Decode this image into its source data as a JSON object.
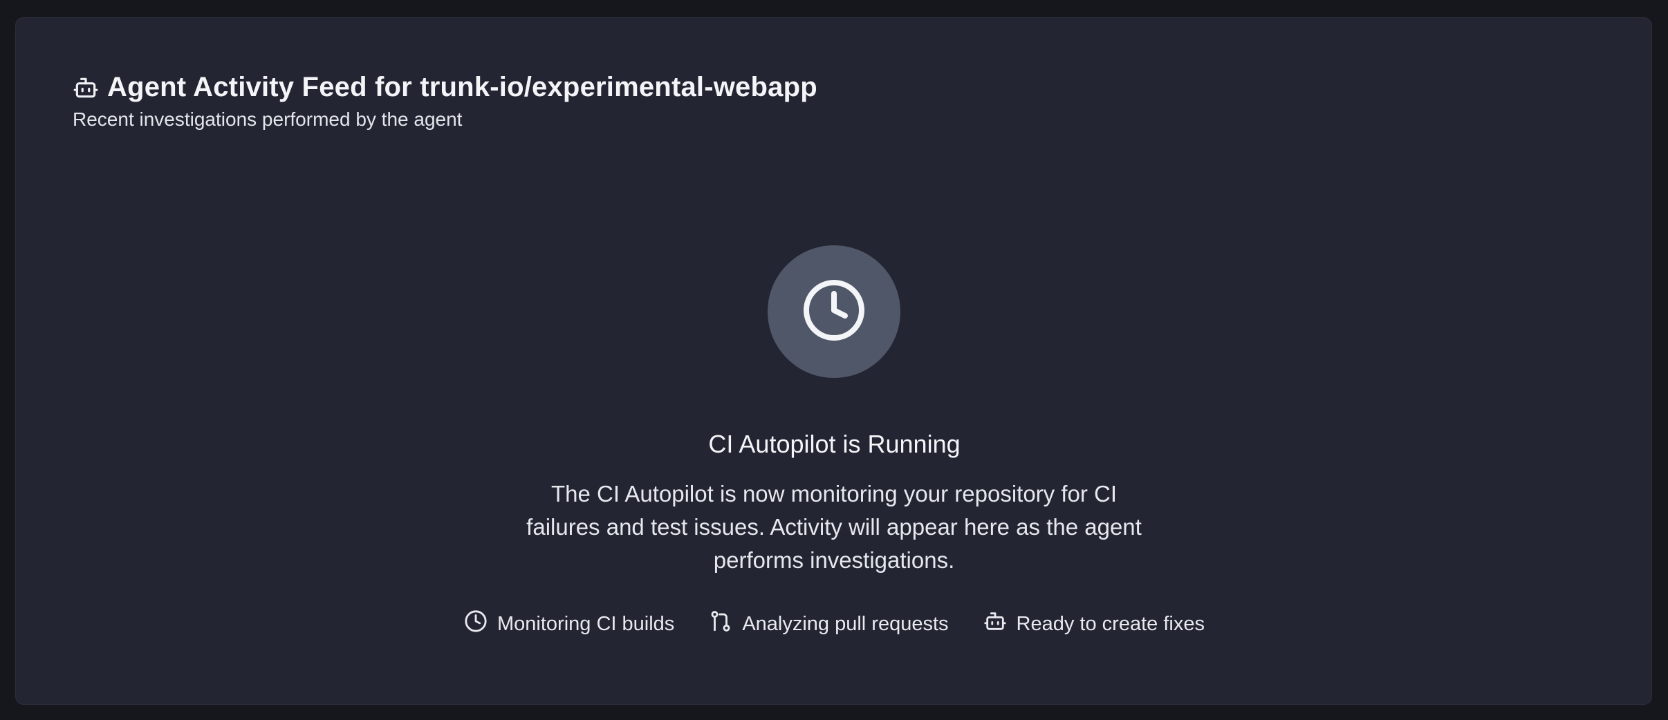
{
  "header": {
    "icon": "bot-icon",
    "title": "Agent Activity Feed for trunk-io/experimental-webapp",
    "subtitle": "Recent investigations performed by the agent"
  },
  "empty_state": {
    "icon": "clock-icon",
    "title": "CI Autopilot is Running",
    "description": "The CI Autopilot is now monitoring your repository for CI failures and test issues. Activity will appear here as the agent performs investigations."
  },
  "features": [
    {
      "icon": "clock-icon",
      "label": "Monitoring CI builds"
    },
    {
      "icon": "git-pull-request-icon",
      "label": "Analyzing pull requests"
    },
    {
      "icon": "bot-icon",
      "label": "Ready to create fixes"
    }
  ],
  "colors": {
    "page_background": "#16171c",
    "card_background": "#232532",
    "icon_circle": "#505768",
    "text": "#f1f2f5"
  }
}
